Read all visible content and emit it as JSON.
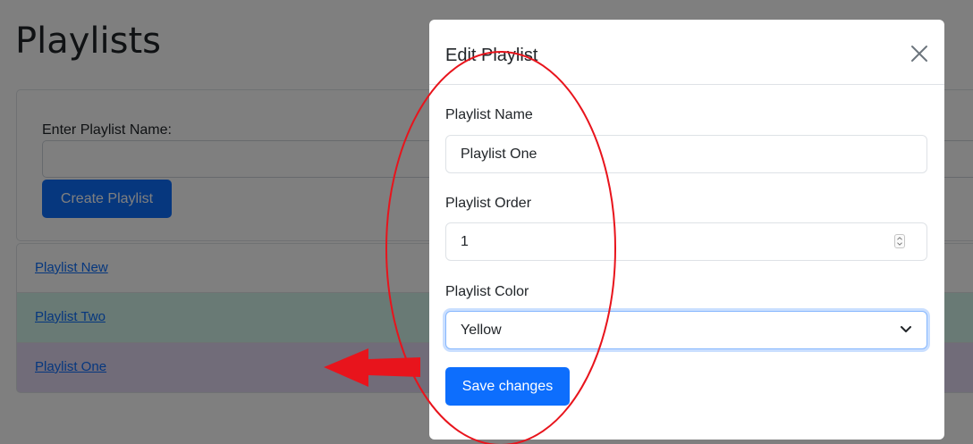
{
  "page": {
    "title": "Playlists",
    "create_form": {
      "label": "Enter Playlist Name:",
      "input_value": "",
      "button_label": "Create Playlist"
    },
    "playlists": [
      {
        "name": "Playlist New",
        "color": "#ffffff"
      },
      {
        "name": "Playlist Two",
        "color": "#d2f4ea"
      },
      {
        "name": "Playlist One",
        "color": "#e2d9f3"
      }
    ]
  },
  "modal": {
    "title": "Edit Playlist",
    "close_icon": "close-icon",
    "name_label": "Playlist Name",
    "name_value": "Playlist One",
    "order_label": "Playlist Order",
    "order_value": "1",
    "color_label": "Playlist Color",
    "color_value": "Yellow",
    "save_label": "Save changes"
  },
  "annotation": {
    "ellipse_color": "#e8141c",
    "arrow_color": "#e8141c",
    "arrow_direction": "left"
  },
  "colors": {
    "accent": "#0d6efd"
  }
}
